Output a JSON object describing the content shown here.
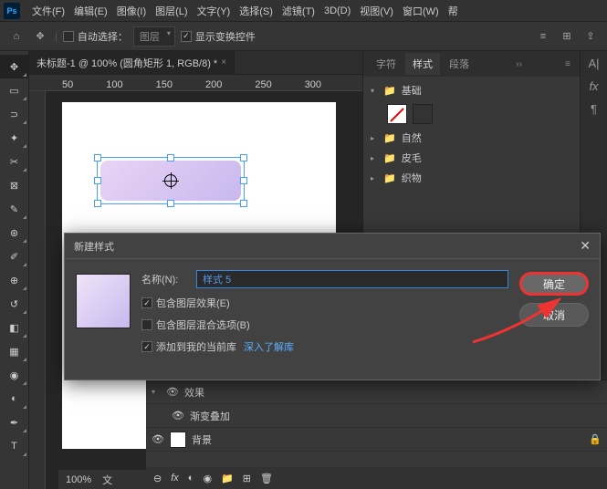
{
  "menu": {
    "file": "文件(F)",
    "edit": "编辑(E)",
    "image": "图像(I)",
    "layer": "图层(L)",
    "type": "文字(Y)",
    "select": "选择(S)",
    "filter": "滤镜(T)",
    "threeD": "3D(D)",
    "view": "视图(V)",
    "window": "窗口(W)",
    "help": "帮"
  },
  "options": {
    "autoSelect": "自动选择：",
    "layerDropdown": "图层",
    "showTransform": "显示变换控件"
  },
  "document": {
    "tab": "未标题-1 @ 100% (圆角矩形 1, RGB/8) *",
    "zoom": "100%",
    "docLabel": "文"
  },
  "ruler": {
    "marks": [
      "50",
      "100",
      "150",
      "200",
      "250",
      "300"
    ]
  },
  "panels": {
    "tabs": {
      "char": "字符",
      "styles": "样式",
      "paragraph": "段落"
    },
    "groups": {
      "basic": "基础",
      "natural": "自然",
      "fur": "皮毛",
      "fabric": "织物"
    }
  },
  "layers": {
    "effects": "效果",
    "gradOverlay": "渐变叠加",
    "background": "背景"
  },
  "dialog": {
    "title": "新建样式",
    "nameLabel": "名称(N):",
    "nameValue": "样式 5",
    "includeEffects": "包含图层效果(E)",
    "includeBlend": "包含图层混合选项(B)",
    "addToLib": "添加到我的当前库",
    "learnMore": "深入了解库",
    "ok": "确定",
    "cancel": "取消"
  }
}
